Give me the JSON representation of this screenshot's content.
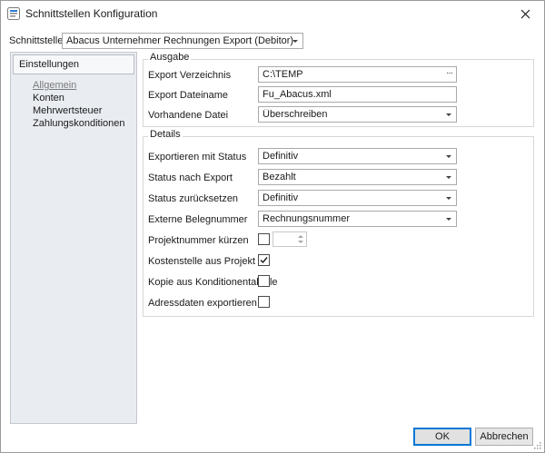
{
  "window": {
    "title": "Schnittstellen Konfiguration"
  },
  "top": {
    "label": "Schnittstelle",
    "selected": "Abacus Unternehmer Rechnungen Export (Debitor)"
  },
  "nav": {
    "header": "Einstellungen",
    "items": [
      {
        "label": "Allgemein",
        "active": true
      },
      {
        "label": "Konten",
        "active": false
      },
      {
        "label": "Mehrwertsteuer",
        "active": false
      },
      {
        "label": "Zahlungskonditionen",
        "active": false
      }
    ]
  },
  "ausgabe": {
    "title": "Ausgabe",
    "export_dir_label": "Export Verzeichnis",
    "export_dir_value": "C:\\TEMP",
    "browse_label": "···",
    "export_file_label": "Export Dateiname",
    "export_file_value": "Fu_Abacus.xml",
    "existing_file_label": "Vorhandene Datei",
    "existing_file_value": "Überschreiben"
  },
  "details": {
    "title": "Details",
    "export_status_label": "Exportieren mit Status",
    "export_status_value": "Definitiv",
    "status_after_label": "Status nach Export",
    "status_after_value": "Bezahlt",
    "status_reset_label": "Status zurücksetzen",
    "status_reset_value": "Definitiv",
    "ext_number_label": "Externe Belegnummer",
    "ext_number_value": "Rechnungsnummer",
    "shorten_label": "Projektnummer kürzen",
    "shorten_checked": false,
    "cost_center_label": "Kostenstelle aus Projekt",
    "cost_center_checked": true,
    "copy_conditions_label": "Kopie aus Konditionentabelle",
    "copy_conditions_checked": false,
    "address_export_label": "Adressdaten exportieren",
    "address_export_checked": false
  },
  "buttons": {
    "ok": "OK",
    "cancel": "Abbrechen"
  },
  "colors": {
    "accent": "#0078d7",
    "nav_bg": "#e9ecf1"
  }
}
